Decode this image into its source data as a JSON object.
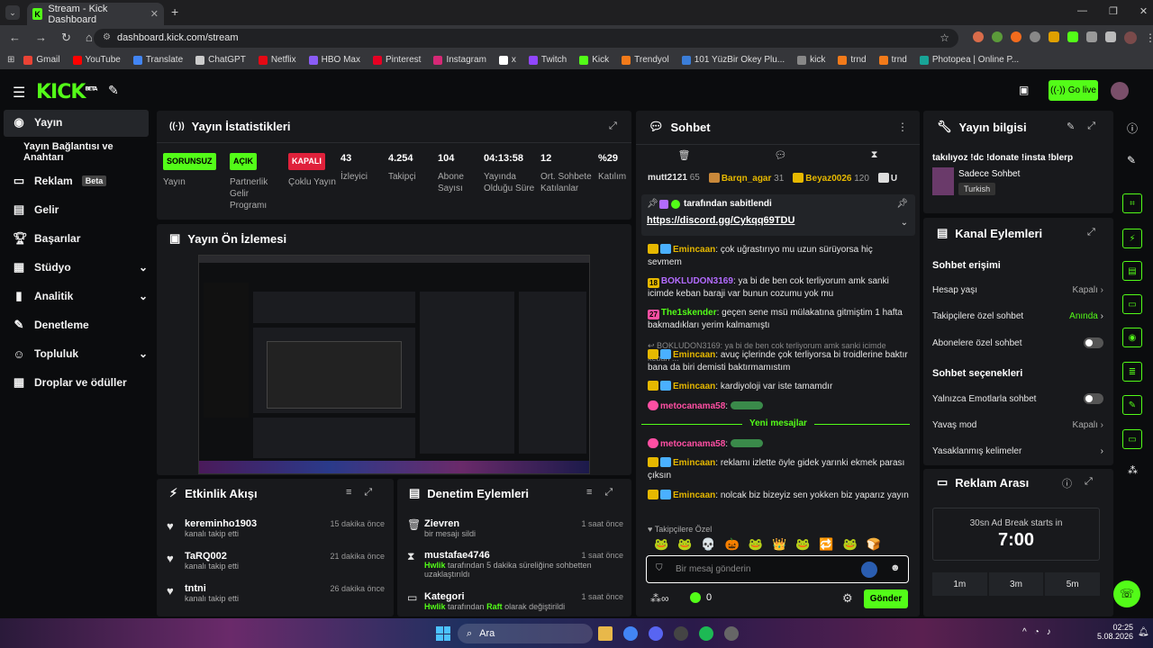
{
  "browser": {
    "tab_title": "Stream - Kick Dashboard",
    "url": "dashboard.kick.com/stream",
    "bookmarks": [
      {
        "label": "Gmail",
        "color": "#ea4335"
      },
      {
        "label": "YouTube",
        "color": "#ff0000"
      },
      {
        "label": "Translate",
        "color": "#4285f4"
      },
      {
        "label": "ChatGPT",
        "color": "#cccccc"
      },
      {
        "label": "Netflix",
        "color": "#e50914"
      },
      {
        "label": "HBO Max",
        "color": "#8a5cf6"
      },
      {
        "label": "Pinterest",
        "color": "#e60023"
      },
      {
        "label": "Instagram",
        "color": "#d62976"
      },
      {
        "label": "x",
        "color": "#ffffff"
      },
      {
        "label": "Twitch",
        "color": "#9146ff"
      },
      {
        "label": "Kick",
        "color": "#53fc18"
      },
      {
        "label": "Trendyol",
        "color": "#f27a1a"
      },
      {
        "label": "101 YüzBir Okey Plu...",
        "color": "#3b7dd8"
      },
      {
        "label": "kick",
        "color": "#888888"
      },
      {
        "label": "trnd",
        "color": "#f27a1a"
      },
      {
        "label": "trnd",
        "color": "#f27a1a"
      },
      {
        "label": "Photopea | Online P...",
        "color": "#18a497"
      }
    ]
  },
  "header": {
    "logo": "KICK",
    "beta": "BETA",
    "go_live": "Go live"
  },
  "sidebar": [
    {
      "label": "Yayın",
      "icon": "broadcast-icon"
    },
    {
      "label": "Yayın Bağlantısı ve Anahtarı"
    },
    {
      "label": "Reklam",
      "badge": "Beta"
    },
    {
      "label": "Gelir"
    },
    {
      "label": "Başarılar"
    },
    {
      "label": "Stüdyo"
    },
    {
      "label": "Analitik"
    },
    {
      "label": "Denetleme"
    },
    {
      "label": "Topluluk"
    },
    {
      "label": "Droplar ve ödüller"
    }
  ],
  "stats": {
    "title": "Yayın İstatistikleri",
    "items": [
      {
        "value": "SORUNSUZ",
        "label": "Yayın",
        "pill": "#53fc18"
      },
      {
        "value": "AÇIK",
        "label": "Partnerlik Gelir Programı",
        "pill": "#53fc18"
      },
      {
        "value": "KAPALI",
        "label": "Çoklu Yayın",
        "pill": "#e0213b"
      },
      {
        "value": "43",
        "label": "İzleyici"
      },
      {
        "value": "4.254",
        "label": "Takipçi"
      },
      {
        "value": "104",
        "label": "Abone Sayısı"
      },
      {
        "value": "04:13:58",
        "label": "Yayında Olduğu Süre"
      },
      {
        "value": "12",
        "label": "Ort. Sohbete Katılanlar"
      },
      {
        "value": "%29",
        "label": "Katılım"
      }
    ]
  },
  "preview": {
    "title": "Yayın Ön İzlemesi"
  },
  "activity": {
    "title": "Etkinlik Akışı",
    "items": [
      {
        "user": "kereminho1903",
        "action": "kanalı takip etti",
        "time": "15 dakika önce"
      },
      {
        "user": "TaRQ002",
        "action": "kanalı takip etti",
        "time": "21 dakika önce"
      },
      {
        "user": "tntni",
        "action": "kanalı takip etti",
        "time": "26 dakika önce"
      }
    ]
  },
  "moderation": {
    "title": "Denetim Eylemleri",
    "items": [
      {
        "user": "Zievren",
        "action": "bir mesajı sildi",
        "time": "1 saat önce"
      },
      {
        "user": "mustafae4746",
        "action_by": "Hwlik",
        "action": "tarafından 5 dakika süreliğine sohbetten uzaklaştırıldı",
        "time": "1 saat önce"
      },
      {
        "user": "Kategori",
        "action_by": "Hwlik",
        "action": "tarafından",
        "target": "Raft",
        "action2": "olarak değiştirildi",
        "time": "1 saat önce"
      }
    ]
  },
  "chat": {
    "title": "Sohbet",
    "leaders": [
      {
        "name": "mutt2121",
        "n": "65"
      },
      {
        "name": "Barqn_agar",
        "n": "31"
      },
      {
        "name": "Beyaz0026",
        "n": "120"
      },
      {
        "name": "U"
      }
    ],
    "pinned_by": "tarafından sabitlendi",
    "pinned_link": "https://discord.gg/Cykqq69TDU",
    "messages": [
      {
        "user": "Emincaan",
        "cls": "g",
        "text": "çok uğrastırıyo mu uzun sürüyorsa hiç sevmem"
      },
      {
        "user": "BOKLUDON3169",
        "cls": "p",
        "badge": "18",
        "text": "ya bi de ben cok terliyorum amk sanki icimde keban baraji var bunun cozumu yok mu"
      },
      {
        "user": "The1skender",
        "cls": "gr",
        "badge": "27",
        "text": "geçen sene msü mülakatına gitmiştim 1 hafta bakmadıkları yerim kalmamıştı"
      },
      {
        "reply": "BOKLUDON3169: ya bi de ben cok terliyorum amk sanki icimde keban ..."
      },
      {
        "user": "Emincaan",
        "cls": "g",
        "text": "avuç içlerinde çok terliyorsa bi troidlerine baktır bana da biri demisti baktırmamıstım"
      },
      {
        "user": "Emincaan",
        "cls": "g",
        "text": "kardiyoloji var iste tamamdır"
      },
      {
        "user": "metocanama58",
        "cls": "pk",
        "text": ""
      }
    ],
    "new_messages": "Yeni mesajlar",
    "messages2": [
      {
        "user": "metocanama58",
        "cls": "pk",
        "text": ""
      },
      {
        "user": "Emincaan",
        "cls": "g",
        "text": "reklamı izlette öyle gidek yarınki ekmek parası çıksın"
      },
      {
        "user": "Emincaan",
        "cls": "g",
        "text": "nolcak biz bizeyiz sen yokken biz yaparız yayın"
      }
    ],
    "followers_only": "Takipçilere Özel",
    "input_placeholder": "Bir mesaj gönderin",
    "send": "Gönder",
    "points": "0"
  },
  "stream_info": {
    "title": "Yayın bilgisi",
    "stream_title": "takılıyoz !dc !donate !insta !blerp",
    "category": "Sadece Sohbet",
    "tag": "Turkish"
  },
  "channel_actions": {
    "title": "Kanal Eylemleri",
    "access": "Sohbet erişimi",
    "items": [
      {
        "label": "Hesap yaşı",
        "value": "Kapalı",
        "color": "#aaaaaa"
      },
      {
        "label": "Takipçilere özel sohbet",
        "value": "Anında",
        "color": "#53fc18"
      },
      {
        "label": "Abonelere özel sohbet",
        "toggle": true
      }
    ],
    "options": "Sohbet seçenekleri",
    "items2": [
      {
        "label": "Yalnızca Emotlarla sohbet",
        "toggle": true
      },
      {
        "label": "Yavaş mod",
        "value": "Kapalı",
        "color": "#aaaaaa"
      },
      {
        "label": "Yasaklanmış kelimeler",
        "value": "",
        "color": "#aaaaaa"
      }
    ]
  },
  "ad_break": {
    "title": "Reklam Arası",
    "starts": "30sn Ad Break starts in",
    "countdown": "7:00",
    "options": [
      "1m",
      "3m",
      "5m"
    ]
  },
  "taskbar": {
    "search": "Ara",
    "time": "02:25",
    "date": "5.08.2026"
  }
}
